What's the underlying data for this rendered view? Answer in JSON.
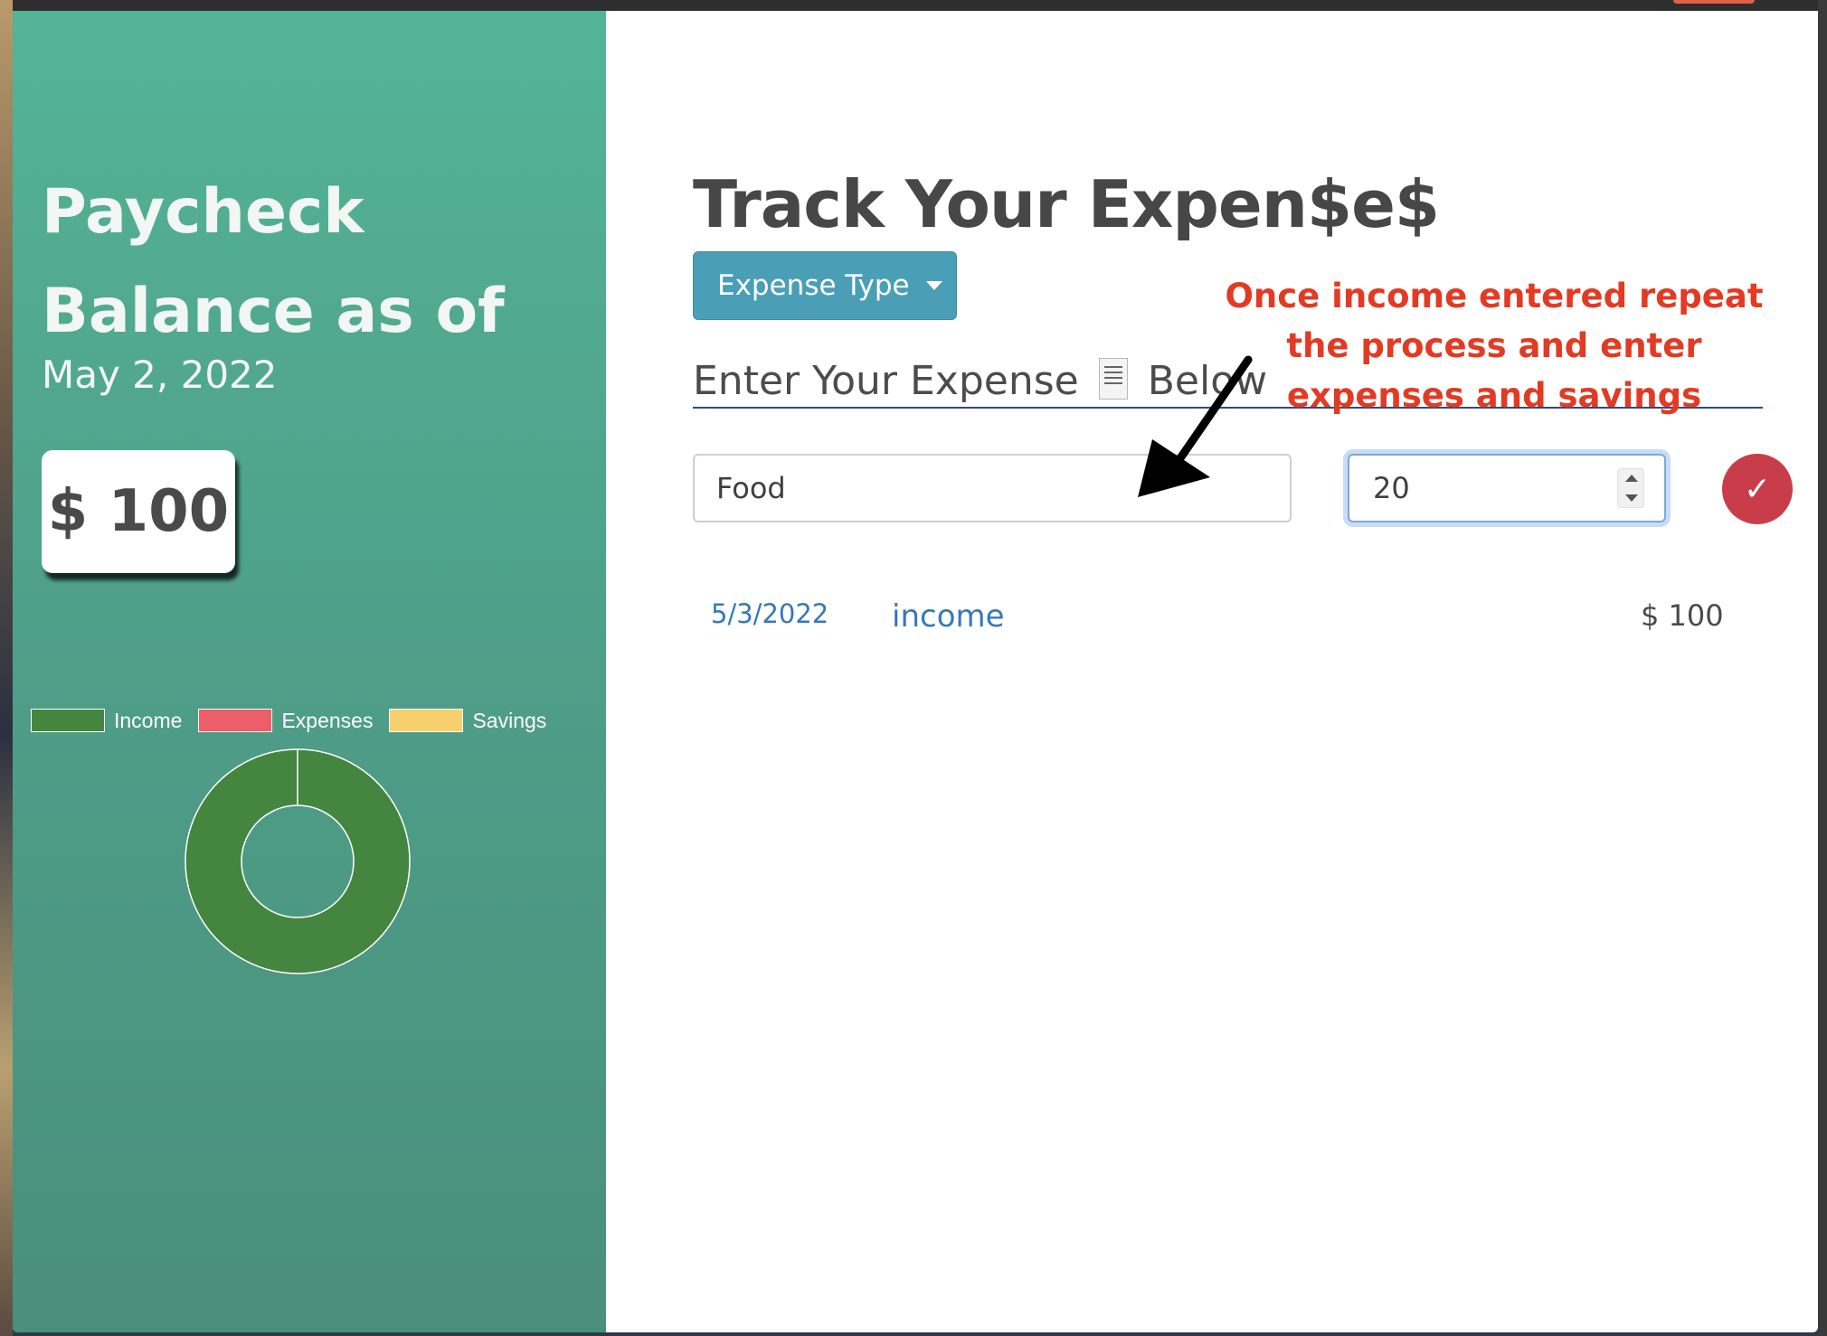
{
  "sidebar": {
    "title": "Paycheck Balance as of",
    "date": "May 2, 2022",
    "balance": "$ 100",
    "legend": [
      {
        "label": "Income",
        "color": "#44853f"
      },
      {
        "label": "Expenses",
        "color": "#ec5e68"
      },
      {
        "label": "Savings",
        "color": "#f6d06c"
      }
    ]
  },
  "chart_data": {
    "type": "pie",
    "categories": [
      "Income",
      "Expenses",
      "Savings"
    ],
    "values": [
      100,
      0,
      0
    ],
    "colors": [
      "#44853f",
      "#ec5e68",
      "#f6d06c"
    ],
    "legend": "top"
  },
  "main": {
    "title": "Track Your Expen$e$",
    "dropdown_label": "Expense Type",
    "enter_label_prefix": "Enter Your Expense",
    "enter_label_suffix": "Below",
    "name_input_value": "Food",
    "amount_input_value": "20",
    "submit_icon": "✓",
    "entries": [
      {
        "date": "5/3/2022",
        "name": "income",
        "amount": "$ 100"
      }
    ]
  },
  "annotation": {
    "lines": [
      "Once income entered repeat",
      "the process and enter",
      "expenses and savings"
    ]
  }
}
